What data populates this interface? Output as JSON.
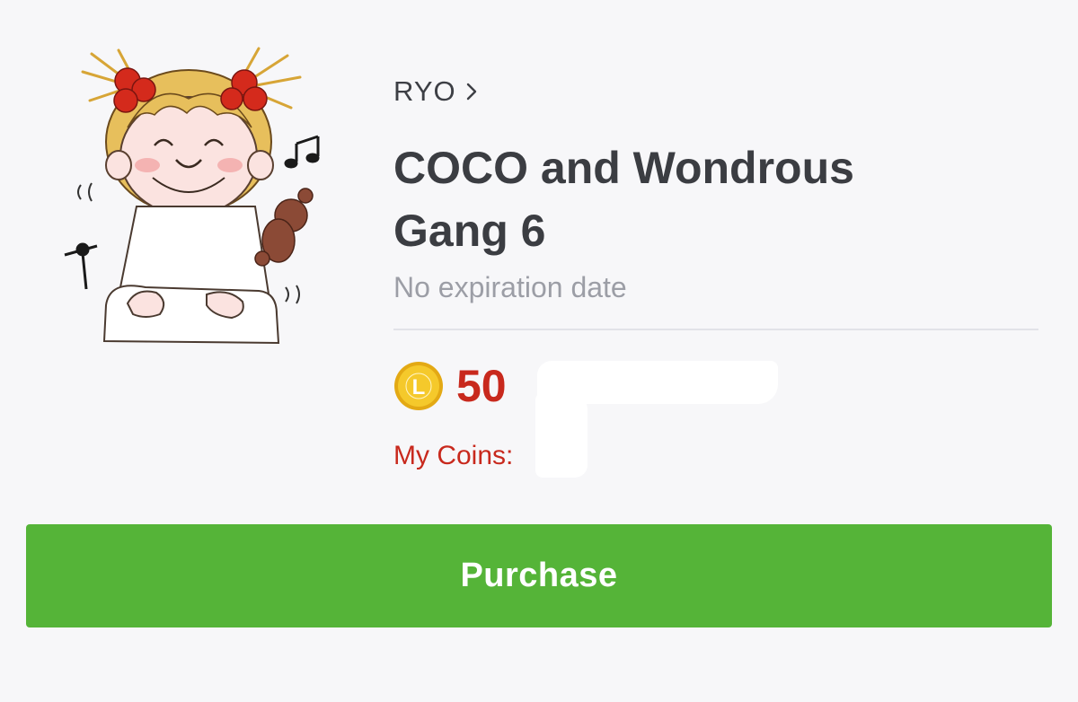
{
  "author": {
    "name": "RYO",
    "chevron_icon": "chevron-right-icon"
  },
  "sticker": {
    "title": "COCO and Wondrous Gang 6",
    "expiry": "No expiration date",
    "image_icon": "sticker-girl-teddy-illustration"
  },
  "price": {
    "coin_letter": "L",
    "amount": "50",
    "coin_icon": "line-coin-icon"
  },
  "wallet": {
    "label": "My Coins:",
    "value": ""
  },
  "actions": {
    "purchase_label": "Purchase"
  },
  "colors": {
    "background": "#f7f7f9",
    "title": "#3b3d42",
    "muted": "#9c9ea6",
    "price": "#c8291d",
    "coin": "#f0c31e",
    "button": "#55b438",
    "button_text": "#ffffff"
  }
}
